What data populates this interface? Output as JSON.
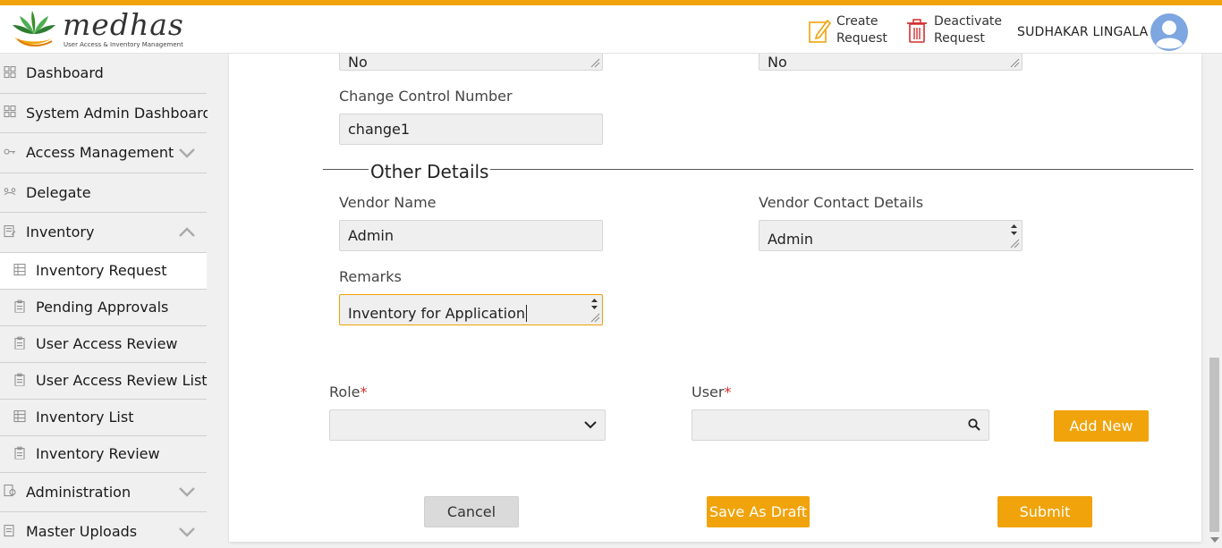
{
  "header": {
    "logo_text": "medhas",
    "logo_subtitle": "User Access & Inventory Management",
    "create_label_1": "Create",
    "create_label_2": "Request",
    "deactivate_label_1": "Deactivate",
    "deactivate_label_2": "Request",
    "user_name": "SUDHAKAR LINGALA"
  },
  "sidebar": {
    "items": [
      {
        "label": "Dashboard"
      },
      {
        "label": "System Admin Dashboard"
      },
      {
        "label": "Access Management"
      },
      {
        "label": "Delegate"
      },
      {
        "label": "Inventory"
      }
    ],
    "sub_items": [
      {
        "label": "Inventory Request"
      },
      {
        "label": "Pending Approvals"
      },
      {
        "label": "User Access Review"
      },
      {
        "label": "User Access Review List"
      },
      {
        "label": "Inventory List"
      },
      {
        "label": "Inventory Review"
      }
    ],
    "bottom_items": [
      {
        "label": "Administration"
      },
      {
        "label": "Master Uploads"
      }
    ]
  },
  "form": {
    "top_left_value": "No",
    "top_right_value": "No",
    "change_control_label": "Change Control Number",
    "change_control_value": "change1",
    "other_details_title": "Other Details",
    "vendor_name_label": "Vendor Name",
    "vendor_name_value": "Admin",
    "vendor_contact_label": "Vendor Contact Details",
    "vendor_contact_value": "Admin",
    "remarks_label": "Remarks",
    "remarks_value": "Inventory for Application",
    "role_label": "Role",
    "user_label": "User",
    "required_mark": "*",
    "add_new_label": "Add New",
    "cancel_label": "Cancel",
    "save_draft_label": "Save As Draft",
    "submit_label": "Submit"
  },
  "colors": {
    "accent": "#f0a30a",
    "danger": "#d32f2f"
  }
}
